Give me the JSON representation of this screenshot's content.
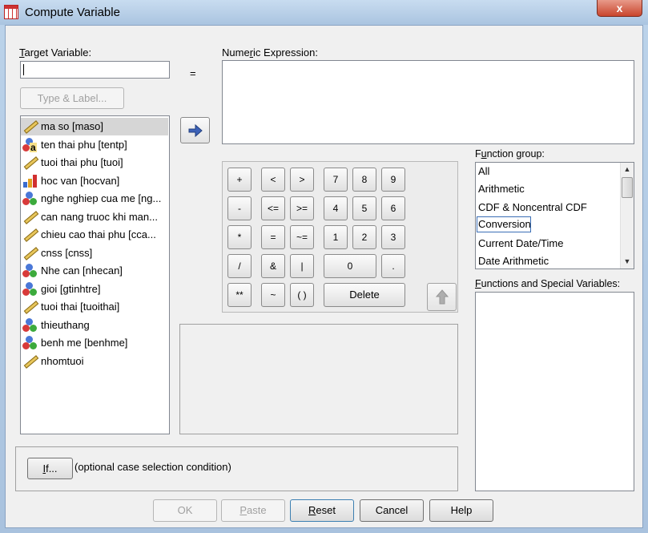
{
  "window": {
    "title": "Compute Variable",
    "close_label": "x"
  },
  "target": {
    "label_pre": "",
    "label_u": "T",
    "label_post": "arget Variable:",
    "value": "",
    "type_label_button": "Type & Label..."
  },
  "equals": "=",
  "expression": {
    "label_pre": "Nume",
    "label_u": "r",
    "label_post": "ic Expression:",
    "value": ""
  },
  "variables": [
    {
      "label": "ma so [maso]",
      "icon": "ruler-icon",
      "selected": true
    },
    {
      "label": "ten thai phu [tentp]",
      "icon": "string-nominal-icon",
      "selected": false
    },
    {
      "label": "tuoi thai phu [tuoi]",
      "icon": "ruler-icon",
      "selected": false
    },
    {
      "label": "hoc van [hocvan]",
      "icon": "ordinal-bars-icon",
      "selected": false
    },
    {
      "label": "nghe nghiep cua me [ng...",
      "icon": "nominal-icon",
      "selected": false
    },
    {
      "label": "can nang truoc khi man...",
      "icon": "ruler-icon",
      "selected": false
    },
    {
      "label": "chieu cao thai phu [cca...",
      "icon": "ruler-icon",
      "selected": false
    },
    {
      "label": "cnss [cnss]",
      "icon": "ruler-icon",
      "selected": false
    },
    {
      "label": "Nhe can [nhecan]",
      "icon": "nominal-icon",
      "selected": false
    },
    {
      "label": "gioi [gtinhtre]",
      "icon": "nominal-icon",
      "selected": false
    },
    {
      "label": "tuoi thai [tuoithai]",
      "icon": "ruler-icon",
      "selected": false
    },
    {
      "label": "thieuthang",
      "icon": "nominal-icon",
      "selected": false
    },
    {
      "label": "benh me [benhme]",
      "icon": "nominal-icon",
      "selected": false
    },
    {
      "label": "nhomtuoi",
      "icon": "ruler-icon",
      "selected": false
    }
  ],
  "keypad": {
    "row1": [
      "+",
      "<",
      ">",
      "7",
      "8",
      "9"
    ],
    "row2": [
      "-",
      "<=",
      ">=",
      "4",
      "5",
      "6"
    ],
    "row3": [
      "*",
      "=",
      "~=",
      "1",
      "2",
      "3"
    ],
    "row4": [
      "/",
      "&",
      "|",
      "0",
      "."
    ],
    "row5": [
      "**",
      "~",
      "( )",
      "Delete"
    ]
  },
  "function_group": {
    "label_pre": "F",
    "label_u": "u",
    "label_post": "nction group:",
    "items": [
      "All",
      "Arithmetic",
      "CDF & Noncentral CDF",
      "Conversion",
      "Current Date/Time",
      "Date Arithmetic"
    ],
    "focused": "Conversion"
  },
  "functions": {
    "label_pre": "",
    "label_u": "F",
    "label_post": "unctions and Special Variables:"
  },
  "if_section": {
    "if_u": "I",
    "if_post": "f...",
    "caption": "(optional case selection condition)"
  },
  "buttons": {
    "ok": "OK",
    "paste_pre": "",
    "paste_u": "P",
    "paste_post": "aste",
    "reset_pre": "",
    "reset_u": "R",
    "reset_post": "eset",
    "cancel": "Cancel",
    "help": "Help"
  },
  "colors": {
    "selection": "#d6d6d6",
    "window_chrome": "#aac4e0",
    "close_red": "#c9452d",
    "accent_blue": "#3d62b8"
  }
}
